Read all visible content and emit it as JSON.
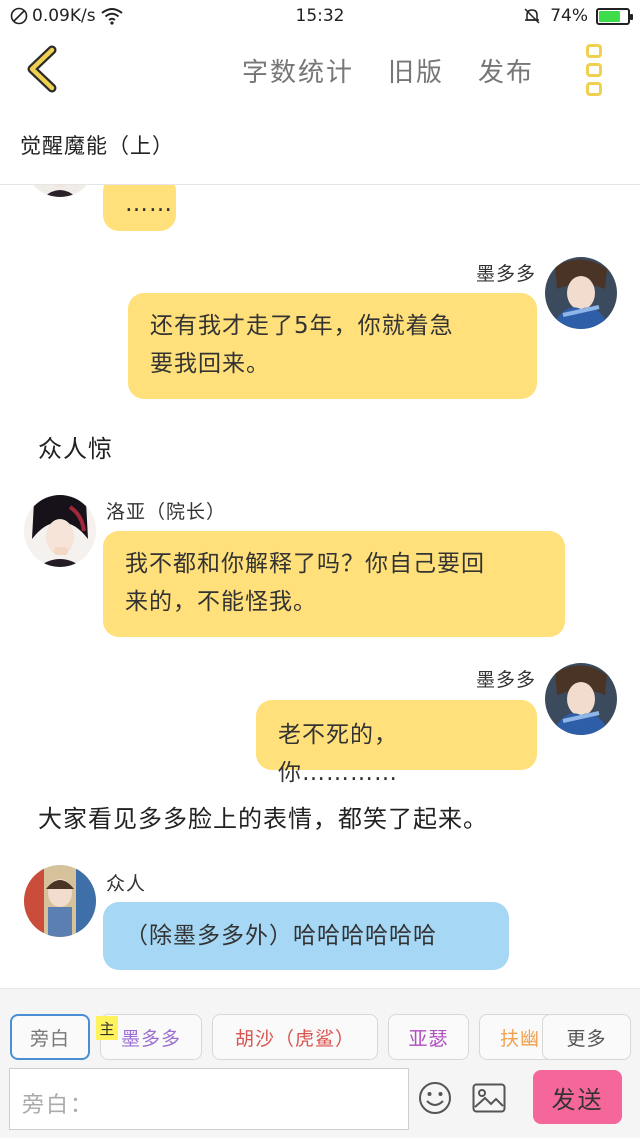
{
  "status": {
    "speed": "0.09K/s",
    "time": "15:32",
    "battery": "74%",
    "battery_level": 0.74
  },
  "header": {
    "actions": [
      "字数统计",
      "旧版",
      "发布"
    ]
  },
  "chapter_title": "觉醒魔能（上）",
  "messages": {
    "m0": {
      "text": "……"
    },
    "m1": {
      "speaker": "墨多多",
      "text_line1": "还有我才走了5年，你就着急",
      "text_line2": "要我回来。"
    },
    "n1": {
      "text": "众人惊"
    },
    "m2": {
      "speaker": "洛亚（院长）",
      "text_line1": "我不都和你解释了吗？你自己要回",
      "text_line2": "来的，不能怪我。"
    },
    "m3": {
      "speaker": "墨多多",
      "text": "老不死的，你…………"
    },
    "n2": {
      "text": "大家看见多多脸上的表情，都笑了起来。"
    },
    "m4": {
      "speaker": "众人",
      "text": "（除墨多多外）哈哈哈哈哈哈"
    }
  },
  "roles": {
    "narration": "旁白",
    "main_badge": "主",
    "r1": "墨多多",
    "r2": "胡沙（虎鲨）",
    "r3": "亚瑟",
    "r4": "扶幽",
    "more": "更多"
  },
  "input": {
    "placeholder": "旁白："
  },
  "send_label": "发送",
  "colors": {
    "accent_yellow": "#ffe07a",
    "bubble_blue": "#a6d8f6",
    "send_pink": "#f5679b",
    "role_r1": "#9b6fd1",
    "role_r2": "#d9534f",
    "role_r3": "#b04fc0",
    "role_r4": "#f0a050"
  }
}
